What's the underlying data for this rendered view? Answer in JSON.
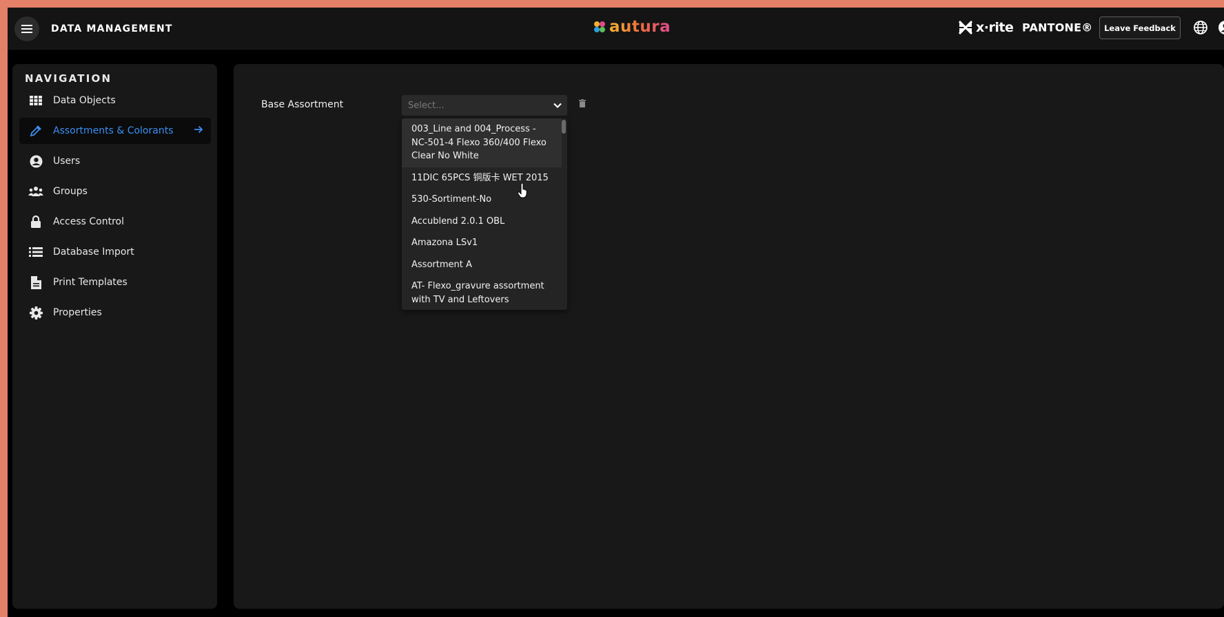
{
  "header": {
    "app_title": "DATA MANAGEMENT",
    "brand_logo": "autura",
    "partner_logo_1": "x·rite",
    "partner_logo_2": "PANTONE®",
    "feedback_label": "Leave Feedback",
    "icons": [
      "menu-icon",
      "globe-icon",
      "user-icon"
    ]
  },
  "sidebar": {
    "heading": "NAVIGATION",
    "items": [
      {
        "label": "Data Objects",
        "icon": "grid-icon"
      },
      {
        "label": "Assortments & Colorants",
        "icon": "dropper-icon",
        "active": true
      },
      {
        "label": "Users",
        "icon": "user-circle-icon"
      },
      {
        "label": "Groups",
        "icon": "group-icon"
      },
      {
        "label": "Access Control",
        "icon": "lock-icon"
      },
      {
        "label": "Database Import",
        "icon": "list-icon"
      },
      {
        "label": "Print Templates",
        "icon": "document-icon"
      },
      {
        "label": "Properties",
        "icon": "gear-icon"
      }
    ]
  },
  "main": {
    "base_assortment": {
      "label": "Base Assortment",
      "placeholder": "Select...",
      "options": [
        "003_Line and 004_Process - NC-501-4 Flexo 360/400 Flexo Clear No White",
        "11DIC 65PCS 铜版卡 WET 2015",
        "530-Sortiment-No",
        "Accublend 2.0.1 OBL",
        "Amazona LSv1",
        "Assortment A",
        "AT- Flexo_gravure assortment with TV and Leftovers"
      ]
    }
  },
  "colors": {
    "accent": "#3b8ff2",
    "frame": "#e58068",
    "panel": "#181818"
  }
}
